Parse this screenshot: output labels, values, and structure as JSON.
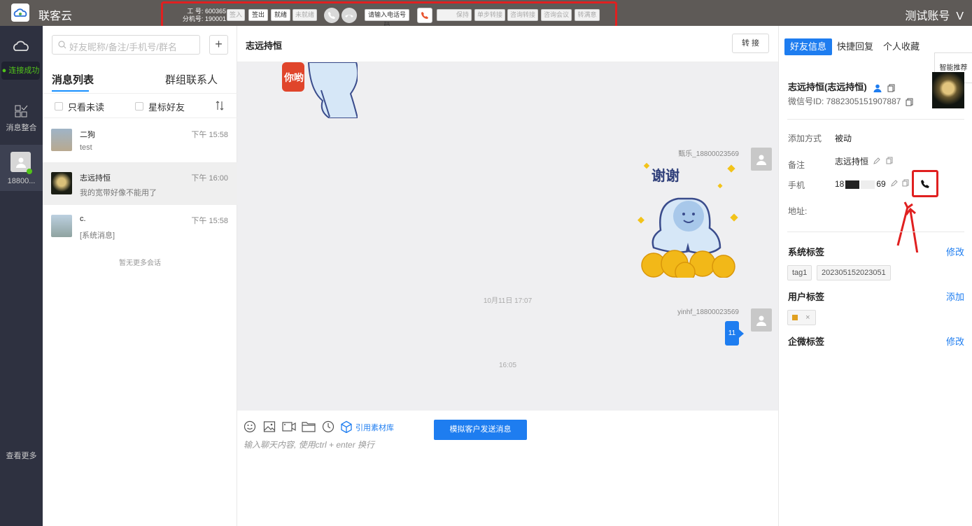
{
  "topbar": {
    "app_title": "联客云",
    "account": "测试账号",
    "account_caret": "V",
    "agent_label": "工   号:",
    "agent_no": "600365",
    "ext_label": "分机号:",
    "ext_no": "190001",
    "buttons": {
      "checkin": "签入",
      "checkout": "签出",
      "busy": "就绪",
      "not_ready": "未就绪",
      "dial_input": "请输入电话号码",
      "hold": "保持",
      "single_transfer": "单步转接",
      "consult_transfer": "咨询转接",
      "consult_meeting": "咨询会议",
      "satisfaction": "转满意"
    }
  },
  "nav": {
    "status": "连接成功",
    "merge_label": "消息整合",
    "account_label": "18800...",
    "more_label": "查看更多"
  },
  "list": {
    "search_placeholder": "好友昵称/备注/手机号/群名",
    "add": "+",
    "tabs": [
      "消息列表",
      "群组联系人"
    ],
    "filter_unread": "只看未读",
    "filter_star": "星标好友",
    "conversations": [
      {
        "name": "二狗",
        "time": "下午 15:58",
        "preview": "test"
      },
      {
        "name": "志远持恒",
        "time": "下午 16:00",
        "preview": "我的宽带好像不能用了"
      },
      {
        "name": "c.",
        "time": "下午 15:58",
        "preview": "[系统消息]"
      }
    ],
    "no_more": "暂无更多会话"
  },
  "chat": {
    "title": "志远持恒",
    "transfer": "转 接",
    "sticker_text_top": "你哟",
    "sender1": "甄乐_18800023569",
    "sticker_text": "谢谢",
    "timestamp1": "10月11日 17:07",
    "sender2": "yinhf_18800023569",
    "bubble_text": "11",
    "timestamp2": "16:05",
    "ref_library": "引用素材库",
    "send_button": "模拟客户发送消息",
    "input_placeholder": "输入聊天内容, 使用ctrl + enter 换行"
  },
  "profile": {
    "tabs": [
      "好友信息",
      "快捷回复",
      "个人收藏"
    ],
    "smart": "智能推荐",
    "name": "志远持恒(志远持恒)",
    "wx_id": "微信号ID: 7882305151907887",
    "add_method_label": "添加方式",
    "add_method": "被动",
    "remark_label": "备注",
    "remark": "志远持恒",
    "phone_label": "手机",
    "phone_prefix": "18",
    "phone_suffix": "69",
    "address_label": "地址:",
    "system_tags_title": "系统标签",
    "system_tags_action": "修改",
    "system_tags": [
      "tag1",
      "202305152023051"
    ],
    "user_tags_title": "用户标签",
    "user_tags_action": "添加",
    "user_tag_close": "×",
    "wecom_tags_title": "企微标签",
    "wecom_tags_action": "修改"
  }
}
